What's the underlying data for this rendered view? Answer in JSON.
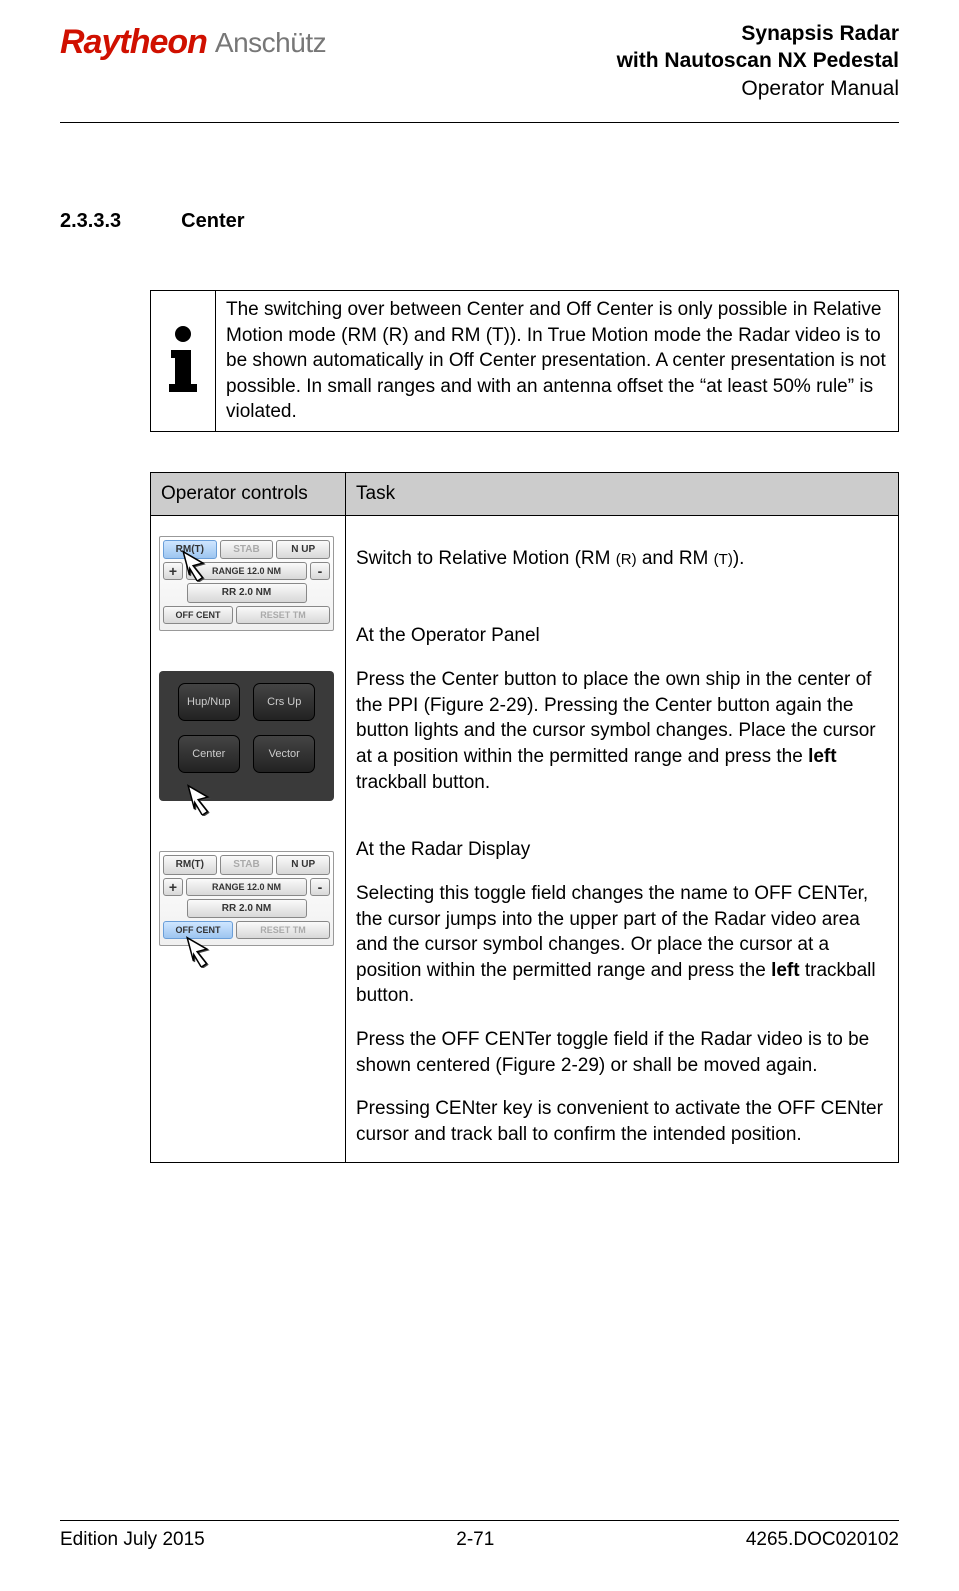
{
  "header": {
    "brand1": "Raytheon",
    "brand2": "Anschütz",
    "title_line1": "Synapsis Radar",
    "title_line2": "with Nautoscan NX Pedestal",
    "title_line3": "Operator Manual"
  },
  "section": {
    "number": "2.3.3.3",
    "title": "Center"
  },
  "info_box_text": "The switching over between Center and Off Center is only possible in Relative Motion mode (RM (R) and RM (T)). In True Motion mode the Radar video is to be shown automatically in Off Center presentation. A center presentation is not possible. In small ranges and with an antenna offset the “at least 50% rule” is violated.",
  "table_headers": {
    "col1": "Operator controls",
    "col2": "Task"
  },
  "softpanel": {
    "rm": "RM(T)",
    "stab": "STAB",
    "nup": "N UP",
    "plus": "+",
    "range": "RANGE 12.0 NM",
    "minus": "-",
    "rr": "RR 2.0 NM",
    "offcent": "OFF CENT",
    "reset": "RESET TM"
  },
  "hardpanel": {
    "hup": "Hup/Nup",
    "crs": "Crs Up",
    "center": "Center",
    "vector": "Vector"
  },
  "task_text": {
    "p1a": "Switch to Relative Motion (RM ",
    "p1b": "(R)",
    "p1c": " and RM ",
    "p1d": "(T)",
    "p1e": ").",
    "p2": "At the Operator Panel",
    "p3a": "Press the Center button to place the own ship in the center of the PPI (Figure 2-29). Pressing the Center button again the button lights and the cursor symbol changes. Place the cursor at a position within the permitted range and press the ",
    "p3b": "left",
    "p3c": " trackball button.",
    "p4": "At the Radar Display",
    "p5a": "Selecting this toggle field changes the name to OFF CENTer, the cursor jumps into the upper part of the Radar video area and the cursor symbol changes. Or place the cursor at a position within the permitted range and press the ",
    "p5b": "left",
    "p5c": " trackball button.",
    "p6": "Press the OFF CENTer toggle field if the Radar video is to be shown centered (Figure 2-29) or shall be moved again.",
    "p7": "Pressing CENter key is convenient to activate the OFF CENter cursor and track ball to confirm the intended position."
  },
  "footer": {
    "edition": "Edition July 2015",
    "page": "2-71",
    "docnum": "4265.DOC020102"
  }
}
